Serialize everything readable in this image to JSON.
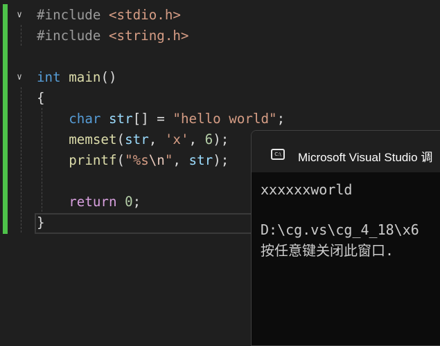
{
  "editor": {
    "lines": [
      {
        "id": "l1",
        "parts": [
          [
            "pp",
            "#include "
          ],
          [
            "hdr",
            "<stdio.h>"
          ]
        ]
      },
      {
        "id": "l2",
        "parts": [
          [
            "pp",
            "#include "
          ],
          [
            "hdr",
            "<string.h>"
          ]
        ]
      },
      {
        "id": "l3",
        "parts": []
      },
      {
        "id": "l4",
        "parts": [
          [
            "ty",
            "int"
          ],
          [
            "punct",
            " "
          ],
          [
            "fn",
            "main"
          ],
          [
            "punct",
            "()"
          ]
        ]
      },
      {
        "id": "l5",
        "parts": [
          [
            "punct",
            "{"
          ]
        ]
      },
      {
        "id": "l6",
        "parts": [
          [
            "punct",
            "    "
          ],
          [
            "ty",
            "char"
          ],
          [
            "punct",
            " "
          ],
          [
            "var",
            "str"
          ],
          [
            "punct",
            "[] = "
          ],
          [
            "str",
            "\"hello world\""
          ],
          [
            "punct",
            ";"
          ]
        ]
      },
      {
        "id": "l7",
        "parts": [
          [
            "punct",
            "    "
          ],
          [
            "fn",
            "memset"
          ],
          [
            "punct",
            "("
          ],
          [
            "var",
            "str"
          ],
          [
            "punct",
            ", "
          ],
          [
            "str",
            "'x'"
          ],
          [
            "punct",
            ", "
          ],
          [
            "num",
            "6"
          ],
          [
            "punct",
            ");"
          ]
        ]
      },
      {
        "id": "l8",
        "parts": [
          [
            "punct",
            "    "
          ],
          [
            "fn",
            "printf"
          ],
          [
            "punct",
            "("
          ],
          [
            "str",
            "\"%s"
          ],
          [
            "esc",
            "\\n"
          ],
          [
            "str",
            "\""
          ],
          [
            "punct",
            ", "
          ],
          [
            "var",
            "str"
          ],
          [
            "punct",
            ");"
          ]
        ]
      },
      {
        "id": "l9",
        "parts": []
      },
      {
        "id": "l10",
        "parts": [
          [
            "punct",
            "    "
          ],
          [
            "ret",
            "return"
          ],
          [
            "punct",
            " "
          ],
          [
            "num",
            "0"
          ],
          [
            "punct",
            ";"
          ]
        ]
      },
      {
        "id": "l11",
        "parts": [
          [
            "punct",
            "}"
          ]
        ]
      }
    ],
    "fold_glyph": "∨"
  },
  "console": {
    "title": "Microsoft Visual Studio 调",
    "icon_label": "C:\\",
    "output_line": "xxxxxxworld",
    "path_line": "D:\\cg.vs\\cg_4_18\\x6",
    "prompt_line": "按任意键关闭此窗口."
  }
}
